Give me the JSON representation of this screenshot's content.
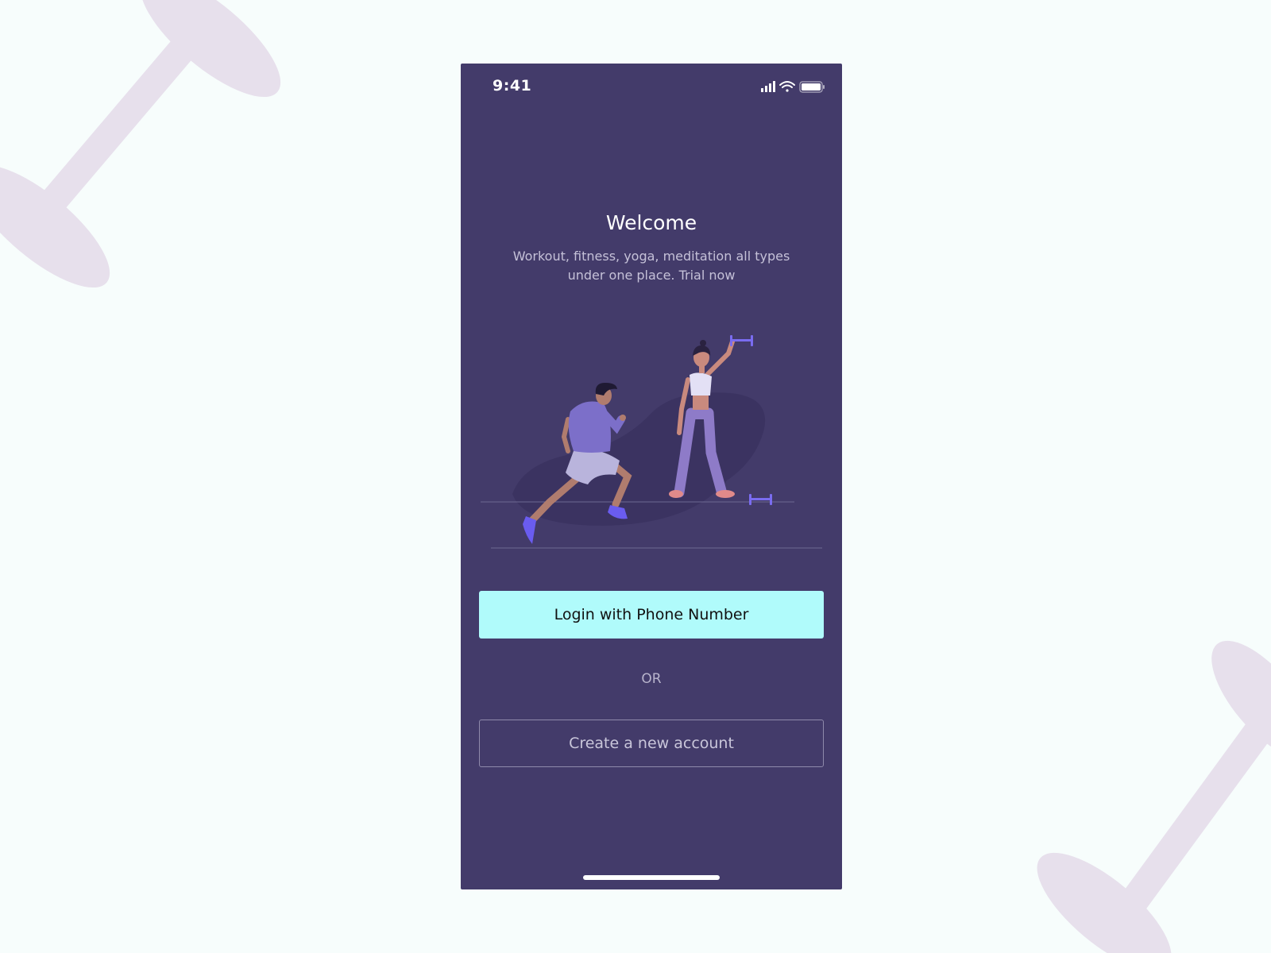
{
  "status_bar": {
    "time": "9:41",
    "icons": [
      "signal-icon",
      "wifi-icon",
      "battery-icon"
    ]
  },
  "welcome": {
    "title": "Welcome",
    "subtitle": "Workout, fitness, yoga, meditation all types under one place. Trial now"
  },
  "illustration": {
    "description_icon": "fitness-illustration"
  },
  "actions": {
    "login_label": "Login with Phone Number",
    "or_label": "OR",
    "create_account_label": "Create a new account"
  },
  "colors": {
    "page_background": "#f7fdfc",
    "phone_background": "#433b6a",
    "primary_button": "#b0fbfb",
    "decor_dumbbell": "#e7e0ec",
    "accent_purple": "#6c63ff"
  }
}
